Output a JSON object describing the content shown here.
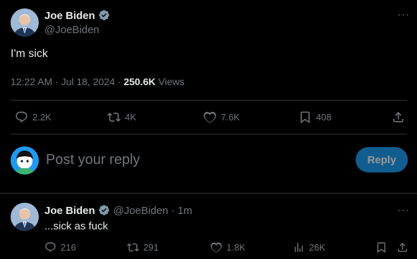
{
  "main_tweet": {
    "name": "Joe Biden",
    "handle": "@JoeBiden",
    "text": "I'm sick",
    "time": "12:22 AM · Jul 18, 2024 · ",
    "views_count": "250.6K",
    "views_label": " Views",
    "actions": {
      "replies": "2.2K",
      "retweets": "4K",
      "likes": "7.6K",
      "bookmarks": "408"
    }
  },
  "composer": {
    "placeholder": "Post your reply",
    "button": "Reply"
  },
  "reply_tweet": {
    "name": "Joe Biden",
    "handle": "@JoeBiden",
    "time": " · 1m",
    "text": "...sick as fuck",
    "actions": {
      "replies": "216",
      "retweets": "291",
      "likes": "1.8K",
      "views": "26K"
    }
  },
  "colors": {
    "background": "#000000",
    "text": "#e7e9ea",
    "muted": "#71767b",
    "accent": "#1d9bf0",
    "divider": "#2f3336"
  },
  "icons": [
    "more-icon",
    "verified-badge-icon",
    "reply-icon",
    "retweet-icon",
    "like-icon",
    "bookmark-icon",
    "share-icon",
    "views-icon"
  ]
}
